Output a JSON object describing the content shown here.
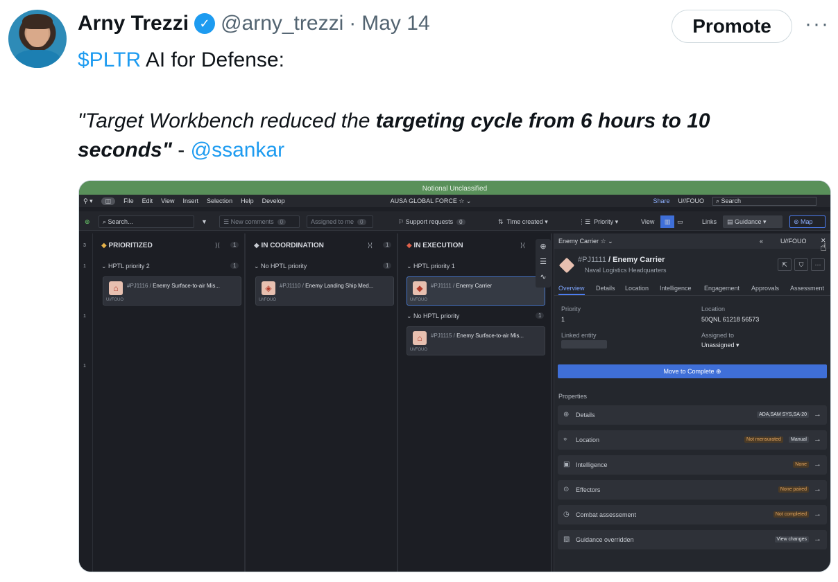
{
  "tweet": {
    "name": "Arny Trezzi",
    "handle": "@arny_trezzi",
    "dot": "·",
    "date": "May 14",
    "promote_label": "Promote",
    "more_label": "···",
    "cashtag": "$PLTR",
    "line1_rest": " AI for Defense:",
    "quote_part1": "\"Target Workbench reduced the ",
    "quote_bold": "targeting cycle from 6 hours to 10 seconds\"",
    "quote_dash": " - ",
    "mention": "@ssankar"
  },
  "app": {
    "banner": "Notional Unclassified",
    "menu": [
      "File",
      "Edit",
      "View",
      "Insert",
      "Selection",
      "Help",
      "Develop"
    ],
    "workspace": "AUSA GLOBAL FORCE ☆ ⌄",
    "share": "Share",
    "classification": "U//FOUO",
    "search_top": "Search",
    "toolbar": {
      "search": "Search...",
      "new_comments": "New comments",
      "new_comments_count": "0",
      "assigned": "Assigned to me",
      "assigned_count": "0",
      "support": "Support requests",
      "support_count": "0",
      "time_created": "Time created ▾",
      "priority": "Priority ▾",
      "view": "View",
      "links": "Links",
      "guidance": "Guidance ▾",
      "map": "Map"
    },
    "left_counts": [
      "3",
      "1",
      "1",
      "1"
    ],
    "columns": [
      {
        "title": "PRIORITIZED",
        "count": "1",
        "groups": [
          {
            "label": "HPTL priority 2",
            "count": "1",
            "cards": [
              {
                "id": "#PJ1116 /",
                "text": "Enemy Surface-to-air Mis...",
                "tag": "U//FOUO",
                "icon": "⌂"
              }
            ]
          }
        ]
      },
      {
        "title": "IN COORDINATION",
        "count": "1",
        "groups": [
          {
            "label": "No HPTL priority",
            "count": "1",
            "cards": [
              {
                "id": "#PJ1110 /",
                "text": "Enemy Landing Ship Med...",
                "tag": "U//FOUO",
                "icon": "◈"
              }
            ]
          }
        ]
      },
      {
        "title": "IN EXECUTION",
        "count": "",
        "groups": [
          {
            "label": "HPTL priority 1",
            "count": "1",
            "cards": [
              {
                "id": "#PJ1111 /",
                "text": "Enemy Carrier",
                "tag": "U//FOUO",
                "icon": "◆"
              }
            ]
          },
          {
            "label": "No HPTL priority",
            "count": "1",
            "cards": [
              {
                "id": "#PJ1115 /",
                "text": "Enemy Surface-to-air Mis...",
                "tag": "U//FOUO",
                "icon": "⌂"
              }
            ]
          }
        ]
      }
    ],
    "panel": {
      "header": "Enemy Carrier ☆ ⌄",
      "header_class": "U//FOUO",
      "id": "#PJ1111",
      "title": "Enemy Carrier",
      "subtitle": "Naval Logistics Headquarters",
      "tabs": [
        "Overview",
        "Details",
        "Location",
        "Intelligence",
        "Engagement",
        "Approvals",
        "Assessment"
      ],
      "priority_label": "Priority",
      "priority_value": "1",
      "location_label": "Location",
      "location_value": "50QNL 61218 56573",
      "linked_label": "Linked entity",
      "assigned_label": "Assigned to",
      "assigned_value": "Unassigned ▾",
      "move_button": "Move to Complete ⊕",
      "properties_label": "Properties",
      "properties": [
        {
          "label": "Details",
          "icon": "⊕",
          "tags": [
            {
              "t": "ADA,SAM SYS,SA-20",
              "k": "w"
            }
          ]
        },
        {
          "label": "Location",
          "icon": "⌖",
          "tags": [
            {
              "t": "Not mensurated",
              "k": "o"
            },
            {
              "t": "Manual",
              "k": "w"
            }
          ]
        },
        {
          "label": "Intelligence",
          "icon": "▣",
          "tags": [
            {
              "t": "None",
              "k": "o"
            }
          ]
        },
        {
          "label": "Effectors",
          "icon": "⊙",
          "tags": [
            {
              "t": "None paired",
              "k": "o"
            }
          ]
        },
        {
          "label": "Combat assessement",
          "icon": "◷",
          "tags": [
            {
              "t": "Not completed",
              "k": "o"
            }
          ]
        },
        {
          "label": "Guidance overridden",
          "icon": "▧",
          "tags": [
            {
              "t": "View changes",
              "k": "w"
            }
          ]
        }
      ]
    }
  }
}
